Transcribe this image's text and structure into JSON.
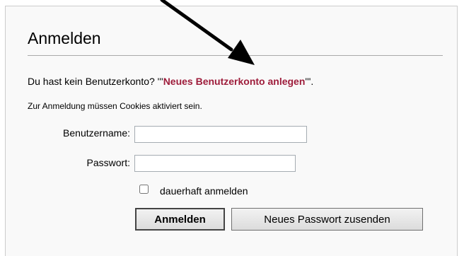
{
  "login": {
    "title": "Anmelden",
    "no_account_prefix": "Du hast kein Benutzerkonto? '''",
    "create_account_link": "Neues Benutzerkonto anlegen",
    "no_account_suffix": "'''.",
    "cookies_notice": "Zur Anmeldung müssen Cookies aktiviert sein.",
    "username_label": "Benutzername:",
    "username_value": "",
    "password_label": "Passwort:",
    "password_value": "",
    "remember_label": "dauerhaft anmelden",
    "remember_checked": false,
    "submit_label": "Anmelden",
    "reset_password_label": "Neues Passwort zusenden"
  },
  "colors": {
    "link": "#9e1d3b",
    "panel_background": "#f9f9f9",
    "arrow": "#000000"
  },
  "annotation": {
    "icon": "arrow-pointer-icon"
  }
}
